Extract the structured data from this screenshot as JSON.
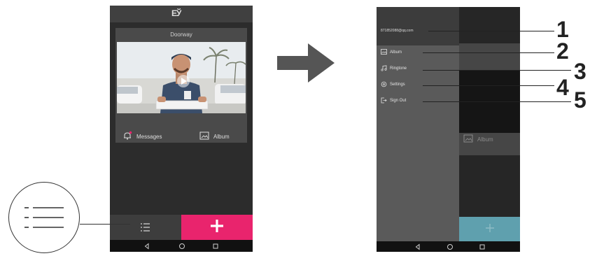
{
  "left_phone": {
    "logo": "ЕЎ",
    "camera": {
      "title": "Doorway"
    },
    "actions": {
      "messages_label": "Messages",
      "album_label": "Album"
    },
    "accent": "#e9246d"
  },
  "right_phone": {
    "drawer": {
      "account_email": "871852088@qq.com",
      "items": [
        {
          "label": "Album",
          "icon": "image-icon"
        },
        {
          "label": "Ringtone",
          "icon": "music-note-icon"
        },
        {
          "label": "Settings",
          "icon": "gear-icon"
        },
        {
          "label": "Sign Out",
          "icon": "sign-out-icon"
        }
      ]
    },
    "background_album_label": "Album"
  },
  "callouts": [
    "1",
    "2",
    "3",
    "4",
    "5"
  ]
}
